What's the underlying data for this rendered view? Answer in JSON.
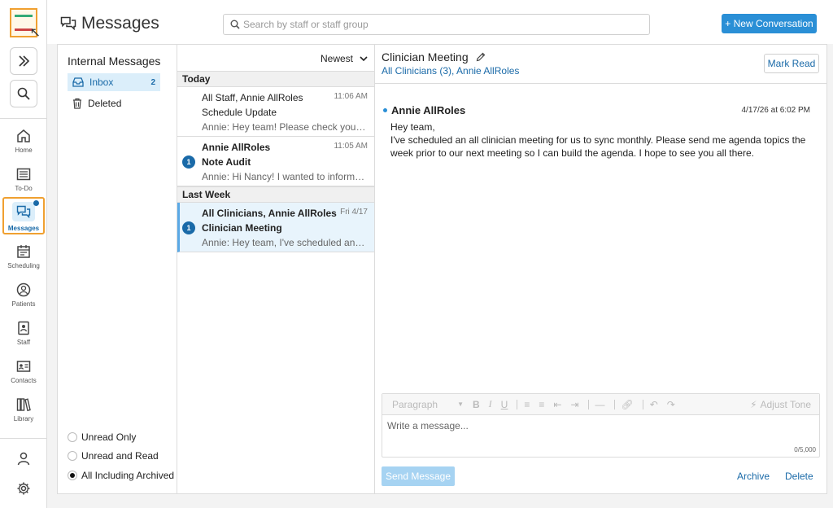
{
  "app": {
    "logo_text": "Therapy Notes"
  },
  "rail": {
    "nav": [
      {
        "id": "home",
        "label": "Home"
      },
      {
        "id": "todo",
        "label": "To-Do"
      },
      {
        "id": "messages",
        "label": "Messages"
      },
      {
        "id": "scheduling",
        "label": "Scheduling"
      },
      {
        "id": "patients",
        "label": "Patients"
      },
      {
        "id": "staff",
        "label": "Staff"
      },
      {
        "id": "contacts",
        "label": "Contacts"
      },
      {
        "id": "library",
        "label": "Library"
      }
    ]
  },
  "header": {
    "title": "Messages",
    "search_placeholder": "Search by staff or staff group",
    "new_conversation_label": "+ New Conversation"
  },
  "folders": {
    "heading": "Internal Messages",
    "items": [
      {
        "label": "Inbox",
        "count": "2"
      },
      {
        "label": "Deleted",
        "count": ""
      }
    ],
    "filters": [
      {
        "label": "Unread Only",
        "selected": false
      },
      {
        "label": "Unread and Read",
        "selected": false
      },
      {
        "label": "All Including Archived",
        "selected": true
      }
    ]
  },
  "list": {
    "sort_label": "Newest",
    "groups": [
      "Today",
      "Last Week"
    ],
    "messages": [
      {
        "from": "All Staff, Annie AllRoles",
        "subject": "Schedule Update",
        "preview": "Annie: Hey team! Please check your inbox for the updated schedule",
        "time": "11:06 AM",
        "badge": ""
      },
      {
        "from": "Annie AllRoles",
        "subject": "Note Audit",
        "preview": "Annie: Hi Nancy! I wanted to inform you about the upcoming note audit",
        "time": "11:05 AM",
        "badge": "1"
      },
      {
        "from": "All Clinicians, Annie AllRoles",
        "subject": "Clinician Meeting",
        "preview": "Annie: Hey team, I've scheduled an all clinician meeting",
        "time": "Fri 4/17",
        "badge": "1"
      }
    ]
  },
  "detail": {
    "title": "Clinician Meeting",
    "participants": "All Clinicians (3), Annie AllRoles",
    "mark_read_label": "Mark Read",
    "sender": "Annie AllRoles",
    "timestamp": "4/17/26 at 6:02 PM",
    "body_greeting": "Hey team,",
    "body_text": "I've scheduled an all clinician meeting for us to sync monthly. Please send me agenda topics the week prior to our next meeting so I can build the agenda. I hope to see you all there.",
    "editor": {
      "paragraph_label": "Paragraph",
      "adjust_tone_label": "Adjust Tone",
      "placeholder": "Write a message...",
      "counter": "0/5,000"
    },
    "send_label": "Send Message",
    "archive_label": "Archive",
    "delete_label": "Delete"
  }
}
